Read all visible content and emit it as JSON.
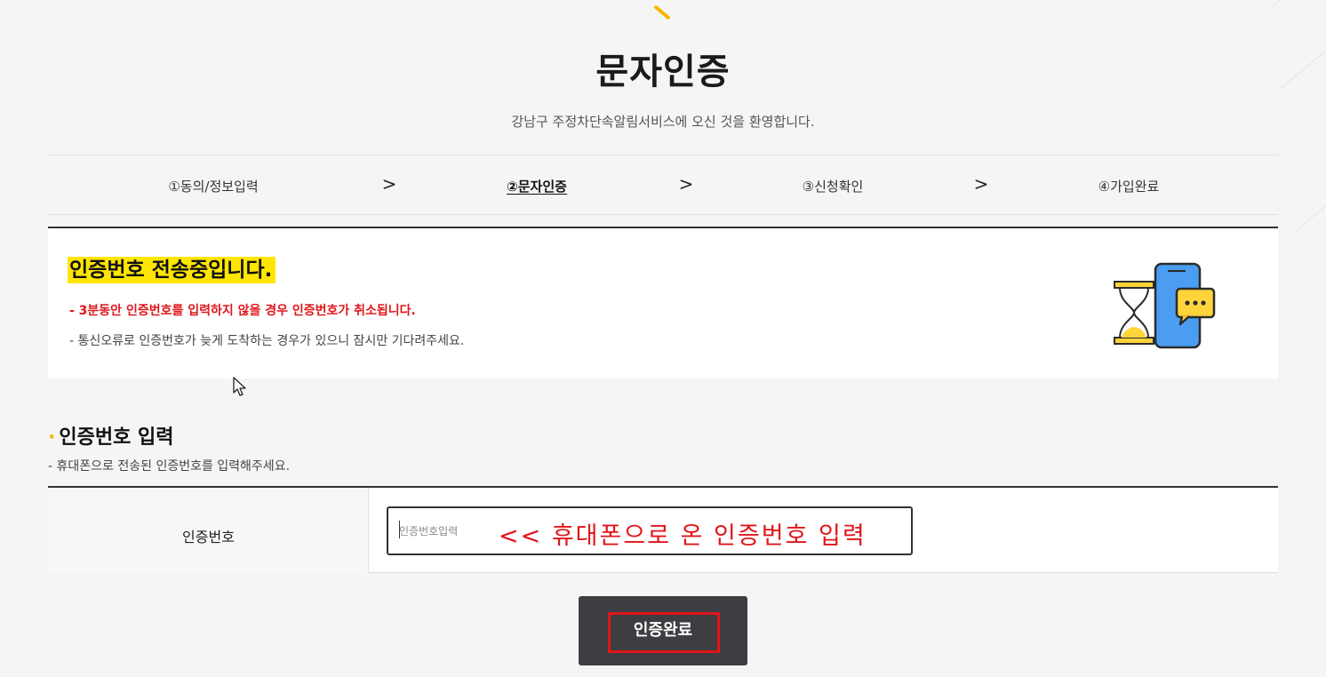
{
  "header": {
    "title": "문자인증",
    "subtitle": "강남구 주정차단속알림서비스에 오신 것을 환영합니다."
  },
  "steps": [
    {
      "label": "①동의/정보입력",
      "active": false
    },
    {
      "label": "②문자인증",
      "active": true
    },
    {
      "label": "③신청확인",
      "active": false
    },
    {
      "label": "④가입완료",
      "active": false
    }
  ],
  "step_separator": ">",
  "notice": {
    "title": "인증번호 전송중입니다.",
    "warning": "- 3분동안 인증번호를 입력하지 않을 경우 인증번호가 취소됩니다.",
    "info": "- 통신오류로 인증번호가 늦게 도착하는 경우가 있으니 잠시만 기다려주세요.",
    "illustration_icon": "hourglass-phone-chat-icon"
  },
  "section": {
    "title": "인증번호 입력",
    "description": "- 휴대폰으로 전송된 인증번호를 입력해주세요."
  },
  "form": {
    "label": "인증번호",
    "value": "",
    "placeholder": "인증번호입력",
    "annotation": "<< 휴대폰으로 온 인증번호 입력"
  },
  "submit": {
    "label": "인증완료"
  },
  "colors": {
    "accent": "#f5b800",
    "highlight": "#ffe600",
    "warning": "#e0161b",
    "button": "#3d3d42"
  }
}
